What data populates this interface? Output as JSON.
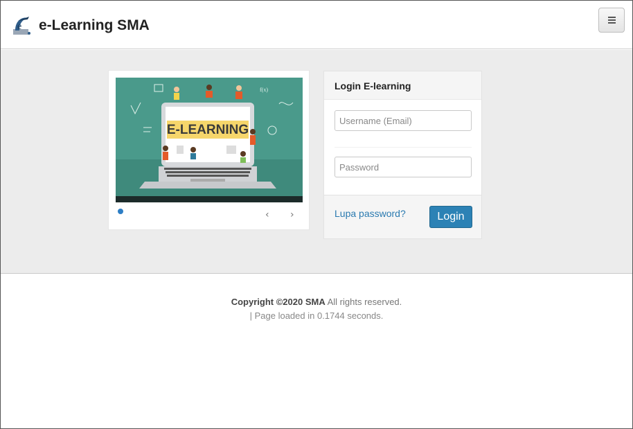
{
  "header": {
    "brand": "e-Learning SMA",
    "logo_icon": "school-crest-logo",
    "menu_icon": "hamburger-menu-icon"
  },
  "slider": {
    "image_text": "E-LEARNING",
    "active_slide": 1,
    "prev_icon": "chevron-left-icon",
    "next_icon": "chevron-right-icon",
    "prev_glyph": "‹",
    "next_glyph": "›"
  },
  "login": {
    "title": "Login E-learning",
    "username_placeholder": "Username (Email)",
    "username_value": "",
    "password_placeholder": "Password",
    "password_value": "",
    "forgot_label": "Lupa password?",
    "submit_label": "Login"
  },
  "footer": {
    "copyright_strong": "Copyright ©2020 SMA",
    "copyright_rest": " All rights reserved.",
    "load_time": "| Page loaded in 0.1744 seconds."
  },
  "colors": {
    "accent": "#2c82b5",
    "link": "#2a7ab0",
    "band": "#ececec",
    "slide_bg": "#4a9a8b",
    "banner_yellow": "#f6d66b"
  }
}
